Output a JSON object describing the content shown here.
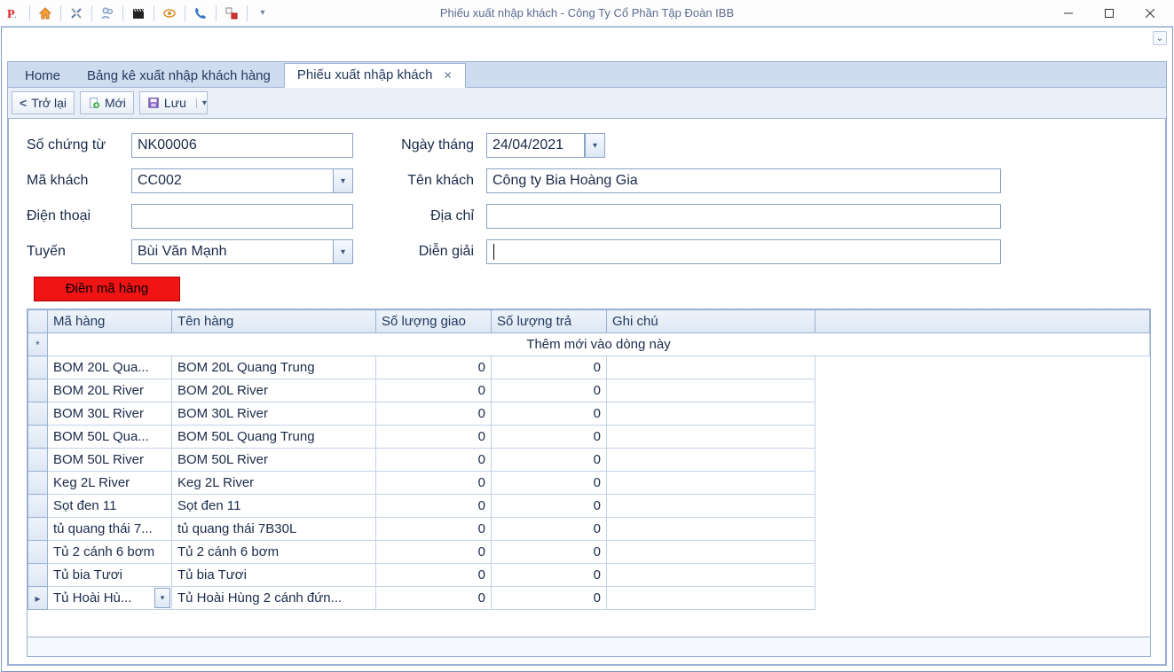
{
  "window": {
    "title": "Phiếu xuất nhập khách - Công Ty Cổ Phần Tập Đoàn IBB"
  },
  "tabs": {
    "home": "Home",
    "list": "Bảng kê xuất nhập khách hàng",
    "doc": "Phiếu xuất nhập khách"
  },
  "toolbar": {
    "back": "Trở lại",
    "new": "Mới",
    "save": "Lưu"
  },
  "form": {
    "voucher_no_label": "Số chứng từ",
    "voucher_no": "NK00006",
    "date_label": "Ngày tháng",
    "date": "24/04/2021",
    "cust_code_label": "Mã khách",
    "cust_code": "CC002",
    "cust_name_label": "Tên khách",
    "cust_name": "Công ty Bia Hoàng Gia",
    "phone_label": "Điện thoại",
    "phone": "",
    "address_label": "Địa chỉ",
    "address": "",
    "route_label": "Tuyến",
    "route": "Bùi Văn Mạnh",
    "note_label": "Diễn giải",
    "note": ""
  },
  "red_button": "Điền mã hàng",
  "grid": {
    "columns": {
      "code": "Mã hàng",
      "name": "Tên hàng",
      "qty_out": "Số lượng giao",
      "qty_in": "Số lượng trả",
      "remark": "Ghi chú"
    },
    "new_row_text": "Thêm mới vào dòng này",
    "rows": [
      {
        "code": "BOM 20L Qua...",
        "name": "BOM 20L Quang Trung",
        "qty_out": 0,
        "qty_in": 0
      },
      {
        "code": "BOM 20L River",
        "name": "BOM 20L River",
        "qty_out": 0,
        "qty_in": 0
      },
      {
        "code": "BOM 30L River",
        "name": "BOM 30L River",
        "qty_out": 0,
        "qty_in": 0
      },
      {
        "code": "BOM 50L Qua...",
        "name": "BOM 50L Quang Trung",
        "qty_out": 0,
        "qty_in": 0
      },
      {
        "code": "BOM 50L River",
        "name": "BOM 50L River",
        "qty_out": 0,
        "qty_in": 0
      },
      {
        "code": "Keg 2L River",
        "name": "Keg 2L River",
        "qty_out": 0,
        "qty_in": 0
      },
      {
        "code": "Sọt đen 11",
        "name": "Sọt đen 11",
        "qty_out": 0,
        "qty_in": 0
      },
      {
        "code": "tủ  quang thái 7...",
        "name": "tủ  quang thái 7B30L",
        "qty_out": 0,
        "qty_in": 0
      },
      {
        "code": "Tủ 2 cánh 6 bơm",
        "name": "Tủ 2 cánh 6 bơm",
        "qty_out": 0,
        "qty_in": 0
      },
      {
        "code": "Tủ bia Tươi",
        "name": "Tủ bia Tươi",
        "qty_out": 0,
        "qty_in": 0
      },
      {
        "code": "Tủ Hoài Hù...",
        "name": "Tủ Hoài Hùng 2 cánh đứn...",
        "qty_out": 0,
        "qty_in": 0,
        "active": true
      }
    ]
  }
}
